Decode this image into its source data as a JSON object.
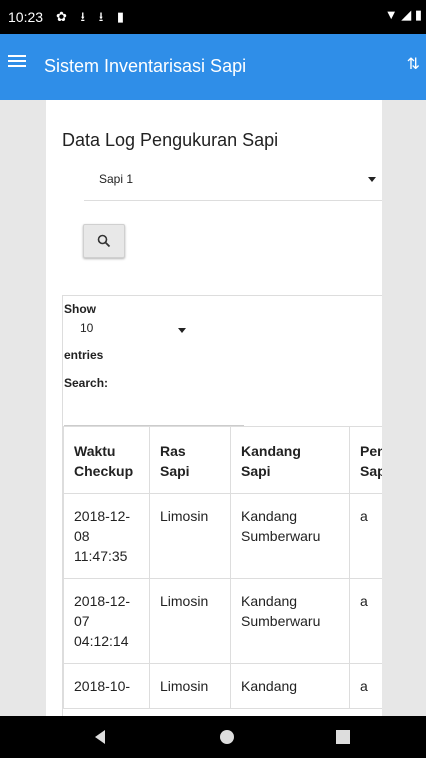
{
  "status_bar": {
    "time": "10:23",
    "left_icons": [
      "settings-icon",
      "download-icon",
      "download-icon",
      "sdcard-icon"
    ],
    "right_icons": [
      "wifi-icon",
      "signal-icon",
      "battery-icon"
    ]
  },
  "app_bar": {
    "title": "Sistem Inventarisasi Sapi",
    "menu_icon": "hamburger-menu-icon",
    "action_icon": "sort-icon"
  },
  "card": {
    "title": "Data Log Pengukuran Sapi",
    "cow_select": {
      "value": "Sapi 1"
    },
    "search_button_icon": "magnifier-icon"
  },
  "datatable": {
    "show_label": "Show",
    "length_value": "10",
    "entries_label": "entries",
    "search_label": "Search:",
    "search_value": "",
    "columns": [
      [
        "Waktu",
        "Checkup"
      ],
      [
        "Ras",
        "Sapi"
      ],
      [
        "Kandang",
        "Sapi"
      ],
      [
        "Pen",
        "Sap"
      ]
    ],
    "rows": [
      {
        "time": [
          "2018-12-",
          "08",
          "11:47:35"
        ],
        "ras": "Limosin",
        "kandang": [
          "Kandang",
          "Sumberwaru"
        ],
        "pen": "a"
      },
      {
        "time": [
          "2018-12-",
          "07",
          "04:12:14"
        ],
        "ras": "Limosin",
        "kandang": [
          "Kandang",
          "Sumberwaru"
        ],
        "pen": "a"
      },
      {
        "time": [
          "2018-10-"
        ],
        "ras": "Limosin",
        "kandang": [
          "Kandang"
        ],
        "pen": "a"
      }
    ]
  },
  "nav_bar": {
    "icons": [
      "back-icon",
      "home-icon",
      "recents-icon"
    ]
  }
}
